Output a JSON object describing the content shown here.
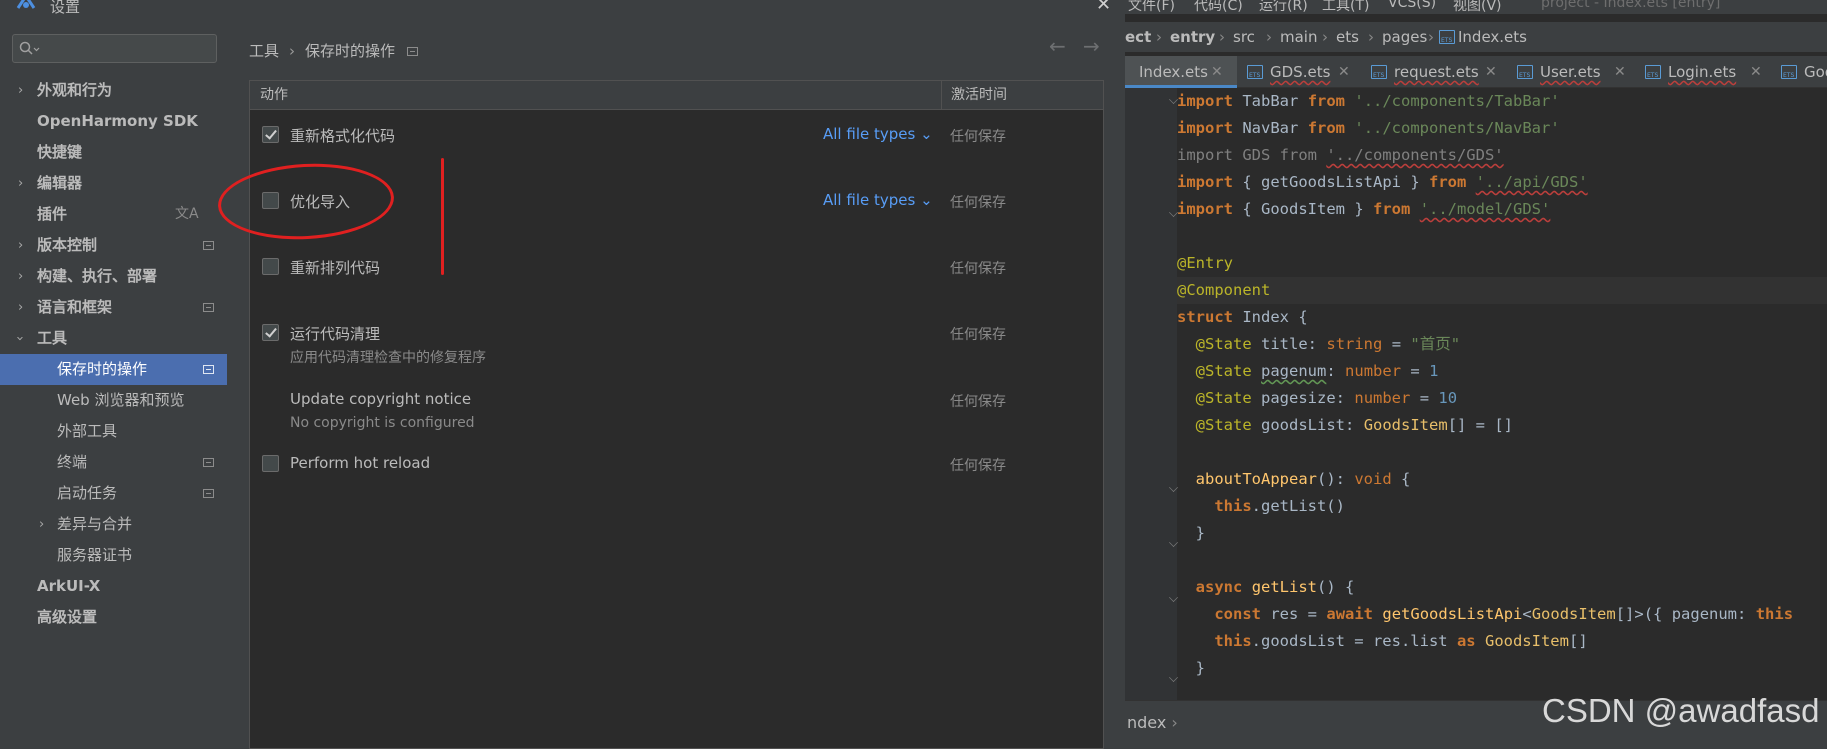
{
  "dialog": {
    "title": "设置",
    "close_glyph": "✕"
  },
  "sidebar": {
    "search_placeholder": "",
    "items": [
      {
        "label": "外观和行为"
      },
      {
        "label": "OpenHarmony SDK"
      },
      {
        "label": "快捷键"
      },
      {
        "label": "编辑器"
      },
      {
        "label": "插件"
      },
      {
        "label": "版本控制"
      },
      {
        "label": "构建、执行、部署"
      },
      {
        "label": "语言和框架"
      },
      {
        "label": "工具"
      },
      {
        "label": "保存时的操作"
      },
      {
        "label": "Web 浏览器和预览"
      },
      {
        "label": "外部工具"
      },
      {
        "label": "终端"
      },
      {
        "label": "启动任务"
      },
      {
        "label": "差异与合并"
      },
      {
        "label": "服务器证书"
      },
      {
        "label": "ArkUI-X"
      },
      {
        "label": "高级设置"
      }
    ]
  },
  "breadcrumb": {
    "parent": "工具",
    "separator": "›",
    "current": "保存时的操作"
  },
  "nav": {
    "back": "←",
    "forward": "→"
  },
  "table": {
    "col_action": "动作",
    "col_trigger": "激活时间",
    "rows": [
      {
        "label": "重新格式化代码",
        "checked": true,
        "file_types": "All file types",
        "trigger": "任何保存"
      },
      {
        "label": "优化导入",
        "checked": false,
        "file_types": "All file types",
        "trigger": "任何保存"
      },
      {
        "label": "重新排列代码",
        "checked": false,
        "trigger": "任何保存"
      },
      {
        "label": "运行代码清理",
        "checked": true,
        "sub": "应用代码清理检查中的修复程序",
        "trigger": "任何保存"
      },
      {
        "label": "Update copyright notice",
        "sub": "No copyright is configured",
        "trigger": "任何保存"
      },
      {
        "label": "Perform hot reload",
        "checked": false,
        "trigger": "任何保存"
      }
    ]
  },
  "editor": {
    "menu": [
      "文件(F)",
      "代码(C)",
      "运行(R)",
      "工具(T)",
      "VCS(S)",
      "视图(V)"
    ],
    "project_title": "project - Index.ets [entry]",
    "path": [
      "ect",
      "entry",
      "src",
      "main",
      "ets",
      "pages",
      "Index.ets"
    ],
    "tabs": [
      "Index.ets",
      "GDS.ets",
      "request.ets",
      "User.ets",
      "Login.ets",
      "Good"
    ],
    "status_crumb": "ndex",
    "status_arrow": "›"
  },
  "watermark": "CSDN @awadfasd"
}
